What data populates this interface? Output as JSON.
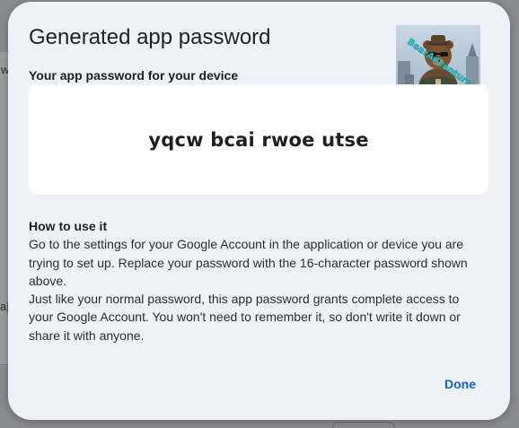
{
  "background": {
    "fragment_w": "w",
    "fragment_ap": "a|"
  },
  "dialog": {
    "title": "Generated app password",
    "subtitle": "Your app password for your device",
    "password": "yqcw bcai rwoe utse",
    "avatar_overlay_text": "BearAdventures",
    "how_to": {
      "heading": "How to use it",
      "paragraph_1": "Go to the settings for your Google Account in the application or device you are trying to set up. Replace your password with the 16-character password shown above.",
      "paragraph_2": "Just like your normal password, this app password grants complete access to your Google Account. You won't need to remember it, so don't write it down or share it with anyone."
    },
    "done_label": "Done"
  },
  "colors": {
    "dialog_bg": "#eef1f8",
    "card_bg": "#ffffff",
    "accent": "#1a5fc8"
  }
}
